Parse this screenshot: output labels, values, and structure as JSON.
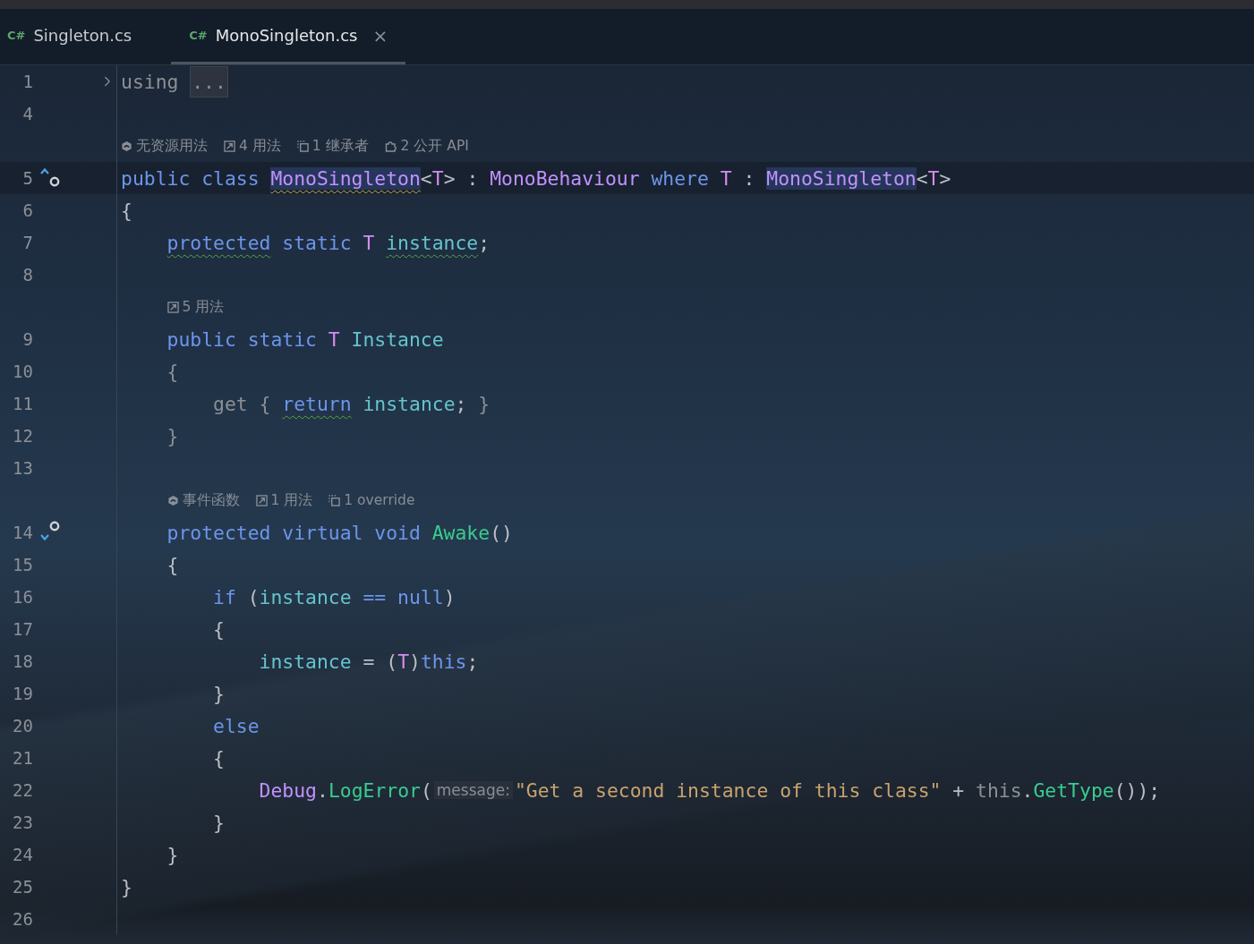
{
  "tabs": [
    {
      "icon_label": "C#",
      "label": "Singleton.cs",
      "selected": false,
      "closable": false
    },
    {
      "icon_label": "C#",
      "label": "MonoSingleton.cs",
      "selected": true,
      "closable": true,
      "close_glyph": "×"
    }
  ],
  "lines": [
    {
      "number": "1",
      "folded": true,
      "tokens": [
        {
          "text": "using",
          "kind": "dim"
        },
        {
          "text": "...",
          "kind": "fold"
        }
      ]
    },
    {
      "number": "4"
    },
    {
      "number": "5",
      "current": true,
      "implemented": true,
      "lens": [
        {
          "kind": "unity",
          "text": "无资源用法"
        },
        {
          "kind": "usages",
          "text": "4 用法"
        },
        {
          "kind": "inheritors",
          "text": "1 继承者"
        },
        {
          "kind": "api",
          "text": "2 公开 API"
        }
      ],
      "tokens": [
        {
          "text": "public class ",
          "kind": "kw"
        },
        {
          "text": "MonoSingleton",
          "kind": "type",
          "warning": true,
          "highlight": true
        },
        {
          "text": "<",
          "kind": "plain"
        },
        {
          "text": "T",
          "kind": "tparam"
        },
        {
          "text": "> : ",
          "kind": "plain"
        },
        {
          "text": "MonoBehaviour",
          "kind": "type"
        },
        {
          "text": " where ",
          "kind": "kw"
        },
        {
          "text": "T",
          "kind": "tparam"
        },
        {
          "text": " : ",
          "kind": "plain"
        },
        {
          "text": "MonoSingleton",
          "kind": "type",
          "highlight": true
        },
        {
          "text": "<",
          "kind": "plain"
        },
        {
          "text": "T",
          "kind": "tparam"
        },
        {
          "text": ">",
          "kind": "plain"
        }
      ]
    },
    {
      "number": "6",
      "tokens": [
        {
          "text": "{",
          "kind": "plain"
        }
      ]
    },
    {
      "children": [
        {
          "number": "7",
          "tokens": [
            {
              "text": "protected",
              "kind": "kw",
              "suggestion": true
            },
            {
              "text": " static ",
              "kind": "kw"
            },
            {
              "text": "T ",
              "kind": "tparam"
            },
            {
              "text": "instance",
              "kind": "field",
              "suggestion": true
            },
            {
              "text": ";",
              "kind": "plain"
            }
          ]
        },
        {
          "number": "8"
        },
        {
          "number": "9",
          "lens": [
            {
              "kind": "usages",
              "text": "5 用法"
            }
          ],
          "tokens": [
            {
              "text": "public static ",
              "kind": "kw"
            },
            {
              "text": "T",
              "kind": "tparam"
            },
            {
              "text": " Instance",
              "kind": "field"
            }
          ]
        },
        {
          "number": "10",
          "tokens": [
            {
              "text": "{",
              "kind": "dim"
            }
          ]
        },
        {
          "children": [
            {
              "number": "11",
              "tokens": [
                {
                  "text": "get { ",
                  "kind": "dim"
                },
                {
                  "text": "return",
                  "kind": "kw",
                  "suggestion": true
                },
                {
                  "text": " instance",
                  "kind": "field"
                },
                {
                  "text": "; ",
                  "kind": "plain"
                },
                {
                  "text": "}",
                  "kind": "dim"
                }
              ]
            }
          ]
        },
        {
          "number": "12",
          "tokens": [
            {
              "text": "}",
              "kind": "dim"
            }
          ]
        },
        {
          "number": "13"
        },
        {
          "number": "14",
          "overridden": true,
          "lens": [
            {
              "kind": "unity",
              "text": "事件函数"
            },
            {
              "kind": "usages",
              "text": "1 用法"
            },
            {
              "kind": "inheritors",
              "text": "1 override"
            }
          ],
          "tokens": [
            {
              "text": "protected virtual void ",
              "kind": "kw"
            },
            {
              "text": "Awake",
              "kind": "method"
            },
            {
              "text": "()",
              "kind": "plain"
            }
          ]
        },
        {
          "number": "15",
          "tokens": [
            {
              "text": "{",
              "kind": "plain"
            }
          ]
        },
        {
          "children": [
            {
              "number": "16",
              "tokens": [
                {
                  "text": "if ",
                  "kind": "kw"
                },
                {
                  "text": "(",
                  "kind": "plain"
                },
                {
                  "text": "instance",
                  "kind": "field"
                },
                {
                  "text": " == null",
                  "kind": "kw"
                },
                {
                  "text": ")",
                  "kind": "plain"
                }
              ]
            },
            {
              "number": "17",
              "tokens": [
                {
                  "text": "{",
                  "kind": "plain"
                }
              ]
            },
            {
              "children": [
                {
                  "number": "18",
                  "tokens": [
                    {
                      "text": "instance",
                      "kind": "field"
                    },
                    {
                      "text": " = (",
                      "kind": "plain"
                    },
                    {
                      "text": "T",
                      "kind": "tparam"
                    },
                    {
                      "text": ")",
                      "kind": "plain"
                    },
                    {
                      "text": "this",
                      "kind": "kw"
                    },
                    {
                      "text": ";",
                      "kind": "plain"
                    }
                  ]
                }
              ]
            },
            {
              "number": "19",
              "tokens": [
                {
                  "text": "}",
                  "kind": "plain"
                }
              ]
            },
            {
              "number": "20",
              "tokens": [
                {
                  "text": "else",
                  "kind": "kw"
                }
              ]
            },
            {
              "number": "21",
              "tokens": [
                {
                  "text": "{",
                  "kind": "plain"
                }
              ]
            },
            {
              "children": [
                {
                  "number": "22",
                  "tokens": [
                    {
                      "text": "Debug",
                      "kind": "type"
                    },
                    {
                      "text": ".",
                      "kind": "plain"
                    },
                    {
                      "text": "LogError",
                      "kind": "method"
                    },
                    {
                      "text": "(",
                      "kind": "plain"
                    },
                    {
                      "text": "message:",
                      "kind": "hint"
                    },
                    {
                      "text": "\"Get a second instance of this class\"",
                      "kind": "string"
                    },
                    {
                      "text": " + ",
                      "kind": "plain"
                    },
                    {
                      "text": "this",
                      "kind": "dim"
                    },
                    {
                      "text": ".",
                      "kind": "plain"
                    },
                    {
                      "text": "GetType",
                      "kind": "method"
                    },
                    {
                      "text": "());",
                      "kind": "plain"
                    }
                  ]
                }
              ]
            },
            {
              "number": "23",
              "tokens": [
                {
                  "text": "}",
                  "kind": "plain"
                }
              ]
            }
          ]
        },
        {
          "number": "24",
          "tokens": [
            {
              "text": "}",
              "kind": "plain"
            }
          ]
        }
      ]
    },
    {
      "number": "25",
      "tokens": [
        {
          "text": "}",
          "kind": "plain"
        }
      ]
    },
    {
      "number": "26"
    }
  ]
}
